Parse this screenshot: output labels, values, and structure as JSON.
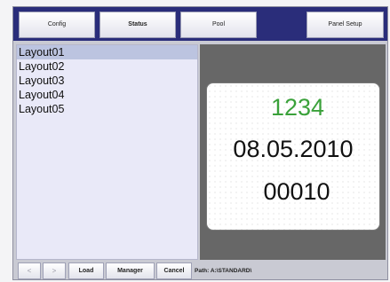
{
  "tabs": [
    {
      "label": "Config"
    },
    {
      "label": "Status"
    },
    {
      "label": "Pool"
    },
    {
      "label": "Panel Setup"
    }
  ],
  "layouts": [
    {
      "label": "Layout01",
      "selected": true
    },
    {
      "label": "Layout02"
    },
    {
      "label": "Layout03"
    },
    {
      "label": "Layout04"
    },
    {
      "label": "Layout05"
    }
  ],
  "panel": {
    "line1": "1234",
    "line1_color": "#3aa13a",
    "line2": "08.05.2010",
    "line3": "00010"
  },
  "footer": {
    "prev_label": "<",
    "next_label": ">",
    "load_label": "Load",
    "manager_label": "Manager",
    "cancel_label": "Cancel",
    "path_label": "Path: A:\\STANDARD\\"
  }
}
